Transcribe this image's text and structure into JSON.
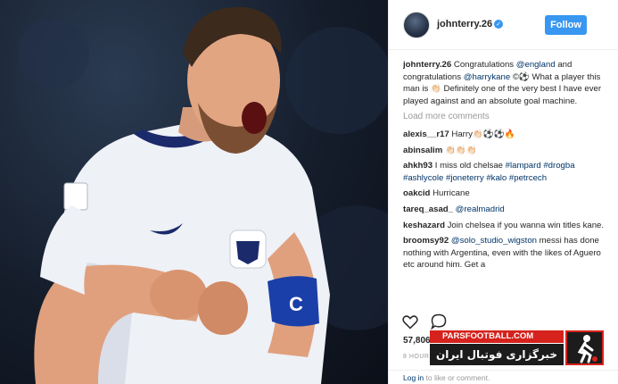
{
  "post": {
    "username": "johnterry.26",
    "follow_label": "Follow"
  },
  "caption": {
    "user": "johnterry.26",
    "part1": "Congratulations",
    "mention1": "@england",
    "part2": "and congratulations",
    "mention2": "@harrykane",
    "part3": "©⚽",
    "part4": "What a player this man is 👏🏻 Definitely one of the very best I have ever played against and an absolute goal machine."
  },
  "load_more": "Load more comments",
  "comments": [
    {
      "user": "alexis__r17",
      "text": "Harry👏🏻⚽⚽🔥"
    },
    {
      "user": "abinsalim",
      "text": "👏🏻👏🏻👏🏻"
    },
    {
      "user": "ahkh93",
      "text": "I miss old chelsae",
      "tags": "#lampard #drogba #ashlycole #joneterry #kalo #petrcech"
    },
    {
      "user": "oakcid",
      "text": "Hurricane"
    },
    {
      "user": "tareq_asad_",
      "mention": "@realmadrid"
    },
    {
      "user": "keshazard",
      "text": "Join chelsea if you wanna win titles kane."
    },
    {
      "user": "broomsy92",
      "mention": "@solo_studio_wigston",
      "text": "messi has done nothing with Argentina, even with the likes of Aguero etc around him. Get a"
    }
  ],
  "likes": "57,806 likes",
  "timestamp": "8 HOURS AGO",
  "login": {
    "link": "Log in",
    "text": "to like or comment."
  },
  "watermark": {
    "site": "PARSFOOTBALL.COM",
    "tagline": "خبرگزاری فوتبال ایران"
  },
  "photo": {
    "armband_letter": "C"
  },
  "colors": {
    "accent": "#3897f0",
    "link": "#003569",
    "watermark_red": "#d6221d"
  }
}
